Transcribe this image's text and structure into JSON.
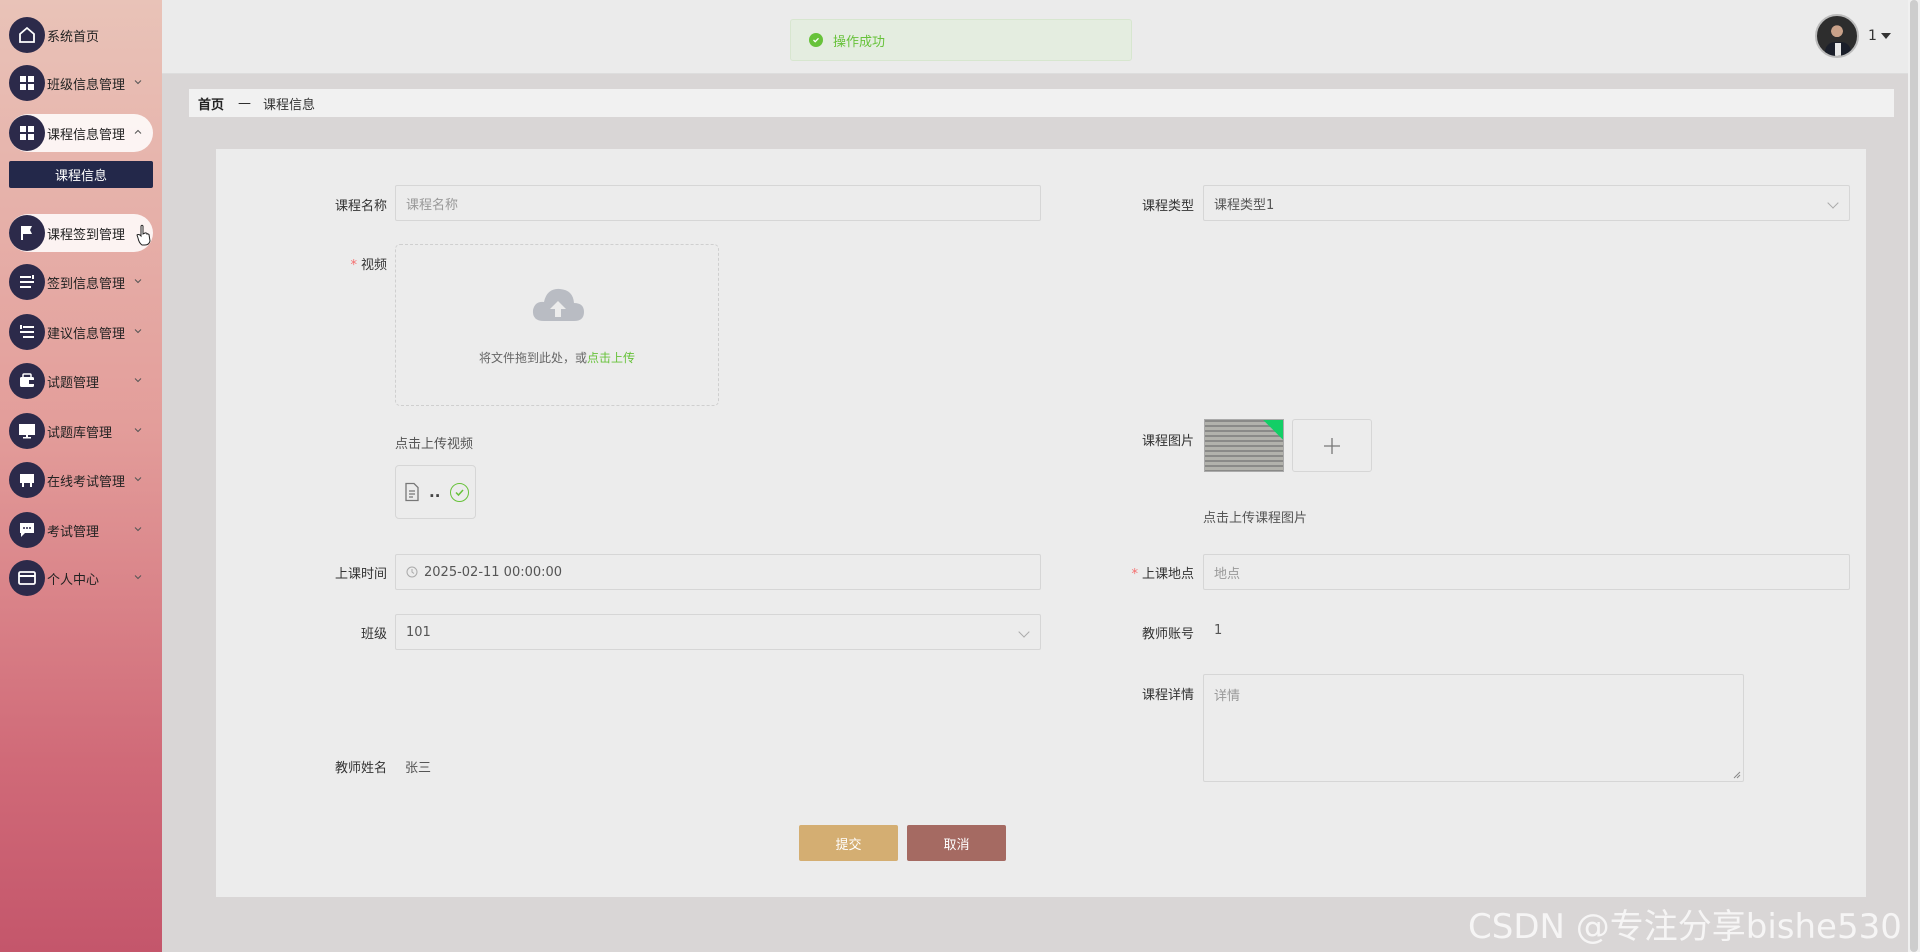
{
  "sidebar": {
    "items": [
      {
        "label": "系统首页",
        "icon": "home-icon",
        "has_arrow": false
      },
      {
        "label": "班级信息管理",
        "icon": "grid-icon",
        "has_arrow": true
      },
      {
        "label": "课程信息管理",
        "icon": "grid-icon",
        "has_arrow": true
      },
      {
        "label": "课程签到管理",
        "icon": "flag-icon",
        "has_arrow": true
      },
      {
        "label": "签到信息管理",
        "icon": "list-icon",
        "has_arrow": true
      },
      {
        "label": "建议信息管理",
        "icon": "list-icon",
        "has_arrow": true
      },
      {
        "label": "试题管理",
        "icon": "wallet-icon",
        "has_arrow": true
      },
      {
        "label": "试题库管理",
        "icon": "monitor-icon",
        "has_arrow": true
      },
      {
        "label": "在线考试管理",
        "icon": "tray-icon",
        "has_arrow": true
      },
      {
        "label": "考试管理",
        "icon": "chat-icon",
        "has_arrow": true
      },
      {
        "label": "个人中心",
        "icon": "card-icon",
        "has_arrow": true
      }
    ],
    "submenu_active": "课程信息"
  },
  "header": {
    "toast": "操作成功",
    "user_name": "1"
  },
  "breadcrumb": {
    "home": "首页",
    "separator": "—",
    "current": "课程信息"
  },
  "form": {
    "course_name": {
      "label": "课程名称",
      "placeholder": "课程名称"
    },
    "course_type": {
      "label": "课程类型",
      "value": "课程类型1"
    },
    "video": {
      "label": "视频",
      "drag_text": "将文件拖到此处，或",
      "drag_link": "点击上传",
      "hint": "点击上传视频",
      "file_name": ".."
    },
    "course_image": {
      "label": "课程图片",
      "hint": "点击上传课程图片"
    },
    "class_time": {
      "label": "上课时间",
      "value": "2025-02-11 00:00:00"
    },
    "location": {
      "label": "上课地点",
      "placeholder": "地点"
    },
    "class": {
      "label": "班级",
      "value": "101"
    },
    "teacher_account": {
      "label": "教师账号",
      "value": "1"
    },
    "course_detail": {
      "label": "课程详情",
      "placeholder": "详情"
    },
    "teacher_name": {
      "label": "教师姓名",
      "value": "张三"
    },
    "submit_label": "提交",
    "cancel_label": "取消"
  },
  "watermark": "CSDN @专注分享bishe530",
  "colors": {
    "accent_green": "#67c23a",
    "submit": "#d4ae72",
    "cancel": "#a56a62",
    "sidebar_dark": "#2c2a4a"
  }
}
